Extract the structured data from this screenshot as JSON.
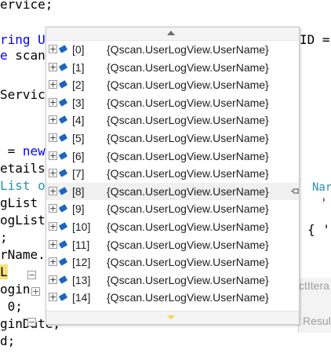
{
  "code": {
    "lines": [
      {
        "parts": [
          "ervice;"
        ]
      },
      {
        "parts": [
          "ring U"
        ]
      },
      {
        "parts": [
          "e scan"
        ]
      },
      {
        "parts": [
          "Servic"
        ]
      },
      {
        "parts": [
          " = new"
        ]
      },
      {
        "parts": [
          "etails"
        ]
      },
      {
        "parts": [
          "List o"
        ]
      },
      {
        "parts": [
          "gList "
        ]
      },
      {
        "parts": [
          "ogList"
        ]
      },
      {
        "parts": [
          ";"
        ]
      },
      {
        "parts": [
          "rName."
        ]
      },
      {
        "parts": [
          "L"
        ]
      },
      {
        "parts": [
          "ogin"
        ]
      },
      {
        "parts": [
          " 0;"
        ]
      },
      {
        "parts": [
          "ginDate;"
        ]
      },
      {
        "parts": [
          "d;"
        ]
      }
    ],
    "right_text": {
      "id_eq": "ID =",
      "nam": "Nar",
      "quote1": "'",
      "brace_quote": "{ '",
      "ctitera": "ctItera",
      "result": "Resul"
    }
  },
  "datatip": {
    "rows": [
      {
        "index": "[0]",
        "value": "{Qscan.UserLogView.UserName}"
      },
      {
        "index": "[1]",
        "value": "{Qscan.UserLogView.UserName}"
      },
      {
        "index": "[2]",
        "value": "{Qscan.UserLogView.UserName}"
      },
      {
        "index": "[3]",
        "value": "{Qscan.UserLogView.UserName}"
      },
      {
        "index": "[4]",
        "value": "{Qscan.UserLogView.UserName}"
      },
      {
        "index": "[5]",
        "value": "{Qscan.UserLogView.UserName}"
      },
      {
        "index": "[6]",
        "value": "{Qscan.UserLogView.UserName}"
      },
      {
        "index": "[7]",
        "value": "{Qscan.UserLogView.UserName}"
      },
      {
        "index": "[8]",
        "value": "{Qscan.UserLogView.UserName}"
      },
      {
        "index": "[9]",
        "value": "{Qscan.UserLogView.UserName}"
      },
      {
        "index": "[10]",
        "value": "{Qscan.UserLogView.UserName}"
      },
      {
        "index": "[11]",
        "value": "{Qscan.UserLogView.UserName}"
      },
      {
        "index": "[12]",
        "value": "{Qscan.UserLogView.UserName}"
      },
      {
        "index": "[13]",
        "value": "{Qscan.UserLogView.UserName}"
      },
      {
        "index": "[14]",
        "value": "{Qscan.UserLogView.UserName}"
      }
    ],
    "expand_glyph": "+",
    "collapse_glyph": "−",
    "hovered_row_index": "[8]"
  },
  "colors": {
    "keyword": "#0000ff",
    "type": "#2b91af",
    "string": "#a31515",
    "highlight": "#f8e27a",
    "field_icon": "#1b66c4"
  }
}
